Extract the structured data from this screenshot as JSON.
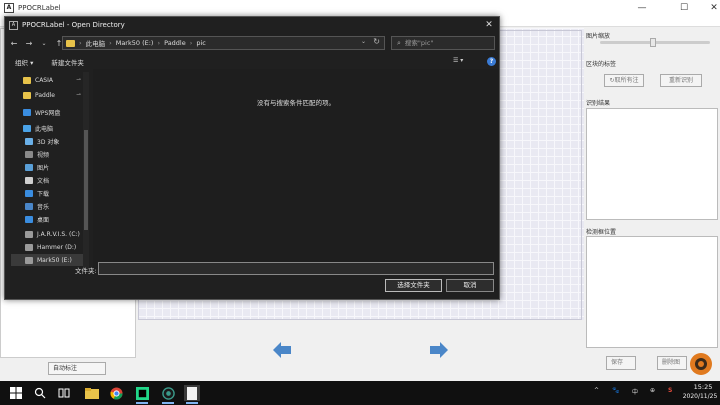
{
  "app": {
    "title": "PPOCRLabel",
    "icon_letter": "A",
    "controls": {
      "minimize": "—",
      "maximize": "☐",
      "close": "✕"
    },
    "right_panel": {
      "zoom_title": "图片缩放",
      "label_title": "区块的标签",
      "label_btn_1": "↻取所有注",
      "label_btn_2": "重新识别",
      "results_title": "识别结果",
      "box_position_title": "检测框位置"
    },
    "bottom": {
      "auto_annotate": "自动标注",
      "save": "保存",
      "recheck": "删除图"
    }
  },
  "dialog": {
    "title": "PPOCRLabel - Open Directory",
    "icon_letter": "A",
    "close": "✕",
    "nav": {
      "back": "←",
      "forward": "→",
      "dropdown": "⌄",
      "up": "↑"
    },
    "path": [
      "此电脑",
      "Mark50 (E:)",
      "Paddle",
      "pic"
    ],
    "path_sep": "›",
    "address_dropdown": "⌄",
    "refresh": "↻",
    "search_placeholder": "搜索\"pic\"",
    "toolbar": {
      "organize": "组织 ▾",
      "new_folder": "新建文件夹",
      "view": "☰ ▾",
      "help": "?"
    },
    "nav_items": [
      {
        "label": "CASIA",
        "icon": "folder-icon",
        "pinned": true
      },
      {
        "label": "Paddle",
        "icon": "folder-icon",
        "pinned": true
      },
      {
        "label": "WPS网盘",
        "icon": "cloud-icon"
      },
      {
        "label": "此电脑",
        "icon": "pc-icon"
      },
      {
        "label": "3D 对象",
        "icon": "cube-icon"
      },
      {
        "label": "视频",
        "icon": "video-icon"
      },
      {
        "label": "图片",
        "icon": "picture-icon"
      },
      {
        "label": "文档",
        "icon": "document-icon"
      },
      {
        "label": "下载",
        "icon": "download-icon"
      },
      {
        "label": "音乐",
        "icon": "music-icon"
      },
      {
        "label": "桌面",
        "icon": "desktop-icon"
      },
      {
        "label": "J.A.R.V.I.S. (C:)",
        "icon": "drive-icon"
      },
      {
        "label": "Hammer (D:)",
        "icon": "drive-icon"
      },
      {
        "label": "Mark50 (E:)",
        "icon": "drive-icon",
        "selected": true
      }
    ],
    "pin_glyph": "⊸",
    "empty_message": "没有与搜索条件匹配的项。",
    "filename_label": "文件夹:",
    "filename_value": "",
    "select_folder": "选择文件夹",
    "cancel": "取消"
  },
  "taskbar": {
    "time": "15:25",
    "date": "2020/11/25",
    "tray_items": [
      "^",
      "🐾",
      "中",
      "⊕",
      "S"
    ]
  },
  "colors": {
    "dialog_bg": "#202020",
    "folder_yellow": "#e8c34a",
    "accent_blue": "#3a7bd5",
    "arrow_blue": "#4a86c8"
  }
}
